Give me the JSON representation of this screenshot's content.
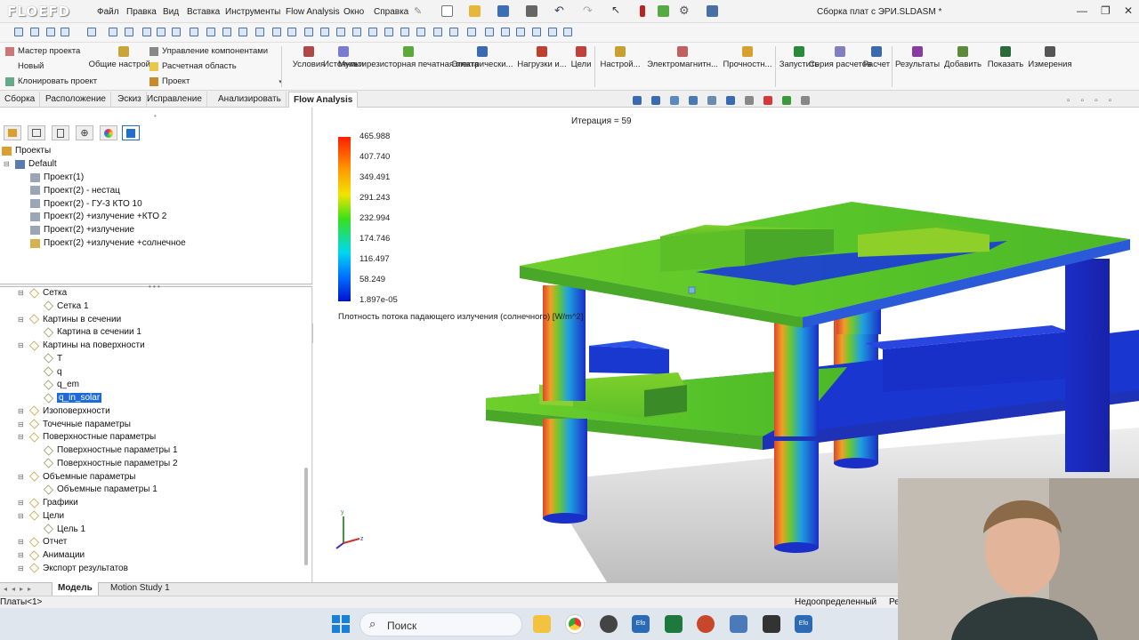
{
  "app": {
    "logo": "FLOEFD",
    "document_title": "Сборка плат с ЭРИ.SLDASM *",
    "menu": [
      "Файл",
      "Правка",
      "Вид",
      "Вставка",
      "Инструменты",
      "Flow Analysis",
      "Окно",
      "Справка"
    ]
  },
  "ribbon": {
    "left_small": [
      "Мастер проекта",
      "Новый",
      "Клонировать проект"
    ],
    "general_settings": "Общие настройки",
    "middle_small": [
      "Управление компонентами",
      "Расчетная область",
      "Проект"
    ],
    "buttons": [
      "Условия",
      "Источники",
      "Мультирезисторная печатная плата",
      "Электрически...",
      "Нагрузки и...",
      "Цели",
      "Настрой...",
      "Электромагнитн...",
      "Прочностн...",
      "Запустить",
      "Серия расчетов",
      "Расчет",
      "Результаты",
      "Добавить",
      "Показать",
      "Измерения"
    ]
  },
  "command_tabs": [
    "Сборка",
    "Расположение",
    "Эскиз",
    "Исправление",
    "Анализировать",
    "Flow Analysis"
  ],
  "active_tab": "Flow Analysis",
  "tree_top": {
    "root": "Проекты",
    "default": "Default",
    "projects": [
      "Проект(1)",
      "Проект(2) - нестац",
      "Проект(2) - ГУ-3 КТО 10",
      "Проект(2) +излучение +КТО 2",
      "Проект(2) +излучение",
      "Проект(2) +излучение +солнечное"
    ]
  },
  "tree_bottom": [
    {
      "label": "Сетка",
      "level": 1
    },
    {
      "label": "Сетка 1",
      "level": 2
    },
    {
      "label": "Картины в сечении",
      "level": 1
    },
    {
      "label": "Картина в сечении 1",
      "level": 2
    },
    {
      "label": "Картины на поверхности",
      "level": 1
    },
    {
      "label": "T",
      "level": 2
    },
    {
      "label": "q",
      "level": 2
    },
    {
      "label": "q_em",
      "level": 2
    },
    {
      "label": "q_in_solar",
      "level": 2,
      "selected": true
    },
    {
      "label": "Изоповерхности",
      "level": 1
    },
    {
      "label": "Точечные параметры",
      "level": 1
    },
    {
      "label": "Поверхностные параметры",
      "level": 1
    },
    {
      "label": "Поверхностные параметры 1",
      "level": 2
    },
    {
      "label": "Поверхностные параметры 2",
      "level": 2
    },
    {
      "label": "Объемные параметры",
      "level": 1
    },
    {
      "label": "Объемные параметры 1",
      "level": 2
    },
    {
      "label": "Графики",
      "level": 1
    },
    {
      "label": "Цели",
      "level": 1
    },
    {
      "label": "Цель 1",
      "level": 2
    },
    {
      "label": "Отчет",
      "level": 1
    },
    {
      "label": "Анимации",
      "level": 1
    },
    {
      "label": "Экспорт результатов",
      "level": 1
    }
  ],
  "viewport": {
    "iteration": "Итерация = 59",
    "legend_values": [
      "465.988",
      "407.740",
      "349.491",
      "291.243",
      "232.994",
      "174.746",
      "116.497",
      "58.249",
      "1.897e-05"
    ],
    "legend_caption": "Плотность потока падающего излучения (солнечного) [W/m^2]",
    "colors": {
      "hot": "#ff2a00",
      "mid": "#5fc81e",
      "cold": "#1428d2"
    }
  },
  "bottom_tabs": [
    "Модель",
    "Motion Study 1"
  ],
  "status": {
    "left": "Платы<1>",
    "state": "Недоопределенный",
    "right": "Ре"
  },
  "taskbar": {
    "search": "Поиск"
  }
}
